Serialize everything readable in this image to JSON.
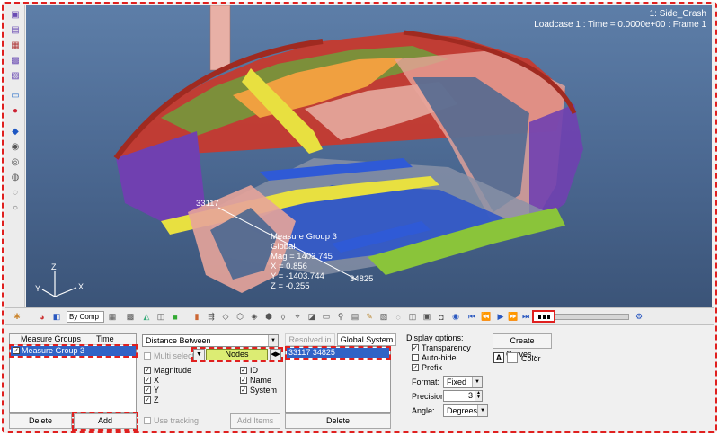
{
  "viewport": {
    "title_line1": "1: Side_Crash",
    "title_line2": "Loadcase 1 : Time = 0.0000e+00 : Frame 1",
    "node_label_1": "33117",
    "node_label_2": "34825",
    "measure_lines": [
      "Measure Group 3",
      "Global",
      "Mag = 1403.745",
      "X = 0.856",
      "Y = -1403.744",
      "Z = -0.255"
    ],
    "axis": {
      "x": "X",
      "y": "Y",
      "z": "Z"
    }
  },
  "toolbar": {
    "color_mode": "By Comp"
  },
  "measure_groups": {
    "col_name": "Measure Groups",
    "col_time": "Time",
    "items": [
      {
        "name": "Measure Group 3",
        "checked": true
      }
    ],
    "delete_label": "Delete",
    "add_label": "Add"
  },
  "measure_def": {
    "type_value": "Distance Between",
    "multi_select_label": "Multi select",
    "entity_label": "Nodes",
    "options_left": [
      "Magnitude",
      "X",
      "Y",
      "Z"
    ],
    "options_right": [
      "ID",
      "Name",
      "System"
    ],
    "use_tracking_label": "Use tracking",
    "add_items_label": "Add Items"
  },
  "resolved": {
    "tab_resolved": "Resolved in",
    "tab_global": "Global System",
    "items": [
      "33117 34825"
    ],
    "delete_label": "Delete"
  },
  "display_options": {
    "title": "Display options:",
    "transparency_label": "Transparency",
    "autohide_label": "Auto-hide",
    "prefix_label": "Prefix",
    "format_label": "Format:",
    "format_value": "Fixed",
    "precision_label": "Precision:",
    "precision_value": "3",
    "angle_label": "Angle:",
    "angle_value": "Degrees"
  },
  "curves": {
    "create_label": "Create Curves...",
    "font_glyph": "A",
    "color_label": "Color"
  },
  "colors": {
    "accent_red": "#e0201f",
    "selection_blue": "#3163c6",
    "nodes_green": "#dcec73",
    "viewport_blue": "#4a6790"
  }
}
